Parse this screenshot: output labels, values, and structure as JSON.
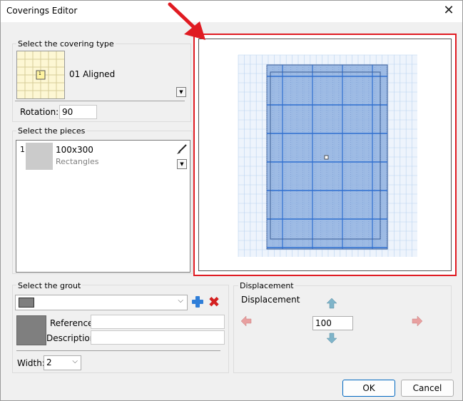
{
  "window": {
    "title": "Coverings Editor"
  },
  "covering_type": {
    "group_label": "Select the covering type",
    "selected": "01 Aligned",
    "thumb_label": "1",
    "rotation_label": "Rotation:",
    "rotation_value": "90"
  },
  "pieces": {
    "group_label": "Select the pieces",
    "items": [
      {
        "index": "1",
        "name": "100x300",
        "kind": "Rectangles"
      }
    ]
  },
  "grout": {
    "group_label": "Select the grout",
    "reference_label": "Reference",
    "description_label": "Description",
    "reference_value": "",
    "description_value": "",
    "width_label": "Width:",
    "width_value": "2"
  },
  "displacement": {
    "group_label": "Displacement",
    "label": "Displacement",
    "value": "100"
  },
  "buttons": {
    "ok": "OK",
    "cancel": "Cancel"
  },
  "colors": {
    "highlight": "#e01b22",
    "accent": "#0067c0",
    "tile": "#8fb0df"
  }
}
